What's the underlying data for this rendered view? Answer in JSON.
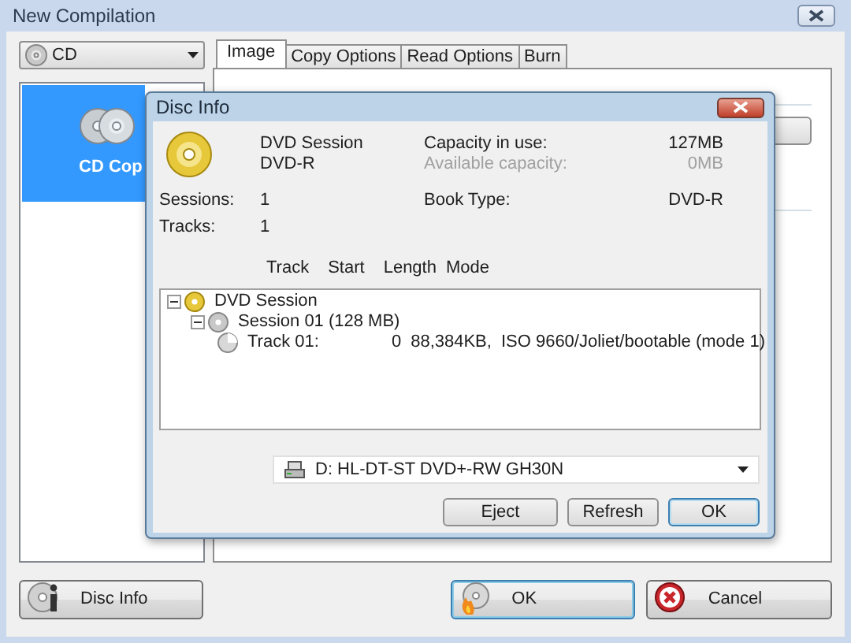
{
  "window": {
    "title": "New Compilation"
  },
  "media_select": {
    "value": "CD"
  },
  "tasks": [
    {
      "label": "CD Cop",
      "selected": true
    }
  ],
  "tabs": [
    {
      "label": "Image",
      "selected": true
    },
    {
      "label": "Copy Options",
      "selected": false
    },
    {
      "label": "Read Options",
      "selected": false
    },
    {
      "label": "Burn",
      "selected": false
    }
  ],
  "dialog": {
    "title": "Disc Info",
    "disc_type": "DVD Session",
    "media": "DVD-R",
    "capacity": [
      {
        "label": "Capacity in use:",
        "value": "127MB",
        "disabled": false
      },
      {
        "label": "Available capacity:",
        "value": "0MB",
        "disabled": true
      }
    ],
    "sessions_label": "Sessions:",
    "sessions": "1",
    "tracks_label": "Tracks:",
    "tracks": "1",
    "book_type_label": "Book Type:",
    "book_type": "DVD-R",
    "columns": [
      "Track",
      "Start",
      "Length",
      "Mode"
    ],
    "tree": [
      {
        "kind": "disc",
        "label": "DVD Session",
        "expanded": true,
        "children": [
          {
            "kind": "session",
            "label": "Session 01 (128 MB)",
            "expanded": true,
            "children": [
              {
                "kind": "track",
                "label": "Track 01:",
                "start": "0",
                "length": "88,384KB,",
                "mode": "ISO 9660/Joliet/bootable (mode 1)"
              }
            ]
          }
        ]
      }
    ],
    "drive": "D: HL-DT-ST DVD+-RW GH30N",
    "buttons": [
      {
        "label": "Eject",
        "default": false
      },
      {
        "label": "Refresh",
        "default": false
      },
      {
        "label": "OK",
        "default": true
      }
    ]
  },
  "buttons": [
    {
      "kind": "info",
      "label": "Disc Info",
      "default": false
    },
    {
      "kind": "burn",
      "label": "OK",
      "default": true
    },
    {
      "kind": "cancel",
      "label": "Cancel",
      "default": false
    }
  ]
}
